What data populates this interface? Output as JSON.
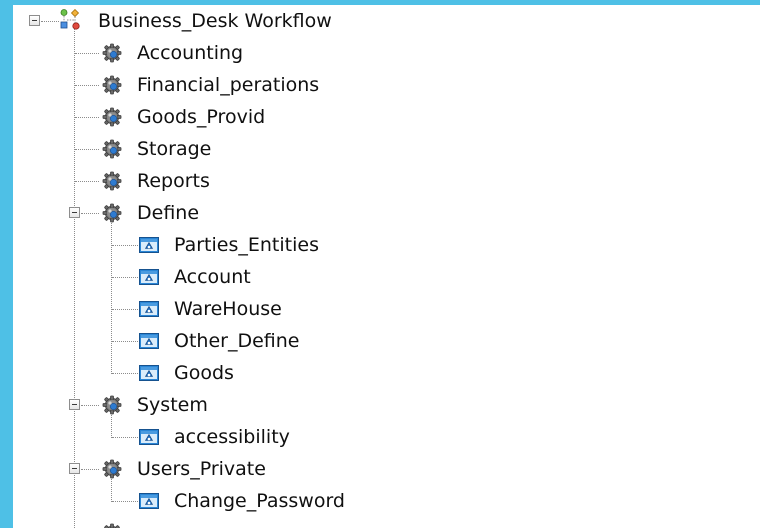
{
  "tree": {
    "root": {
      "label": "Business_Desk Workflow",
      "icon": "workflow-icon"
    },
    "modules": [
      {
        "label": "Accounting",
        "icon": "gear-icon"
      },
      {
        "label": "Financial_perations",
        "icon": "gear-icon"
      },
      {
        "label": "Goods_Provid",
        "icon": "gear-icon"
      },
      {
        "label": "Storage",
        "icon": "gear-icon"
      },
      {
        "label": "Reports",
        "icon": "gear-icon"
      }
    ],
    "define": {
      "label": "Define",
      "icon": "gear-icon",
      "children": [
        {
          "label": "Parties_Entities",
          "icon": "form-icon"
        },
        {
          "label": "Account",
          "icon": "form-icon"
        },
        {
          "label": "WareHouse",
          "icon": "form-icon"
        },
        {
          "label": "Other_Define",
          "icon": "form-icon"
        },
        {
          "label": "Goods",
          "icon": "form-icon"
        }
      ]
    },
    "system": {
      "label": "System",
      "icon": "gear-icon",
      "children": [
        {
          "label": "accessibility",
          "icon": "form-icon"
        }
      ]
    },
    "users_private": {
      "label": "Users_Private",
      "icon": "gear-icon",
      "children": [
        {
          "label": "Change_Password",
          "icon": "form-icon"
        }
      ]
    }
  },
  "colors": {
    "background": "#4ec0e6",
    "panel": "#ffffff",
    "form_icon": "#1f7fd0",
    "gear_icon": "#6e6e6e"
  }
}
